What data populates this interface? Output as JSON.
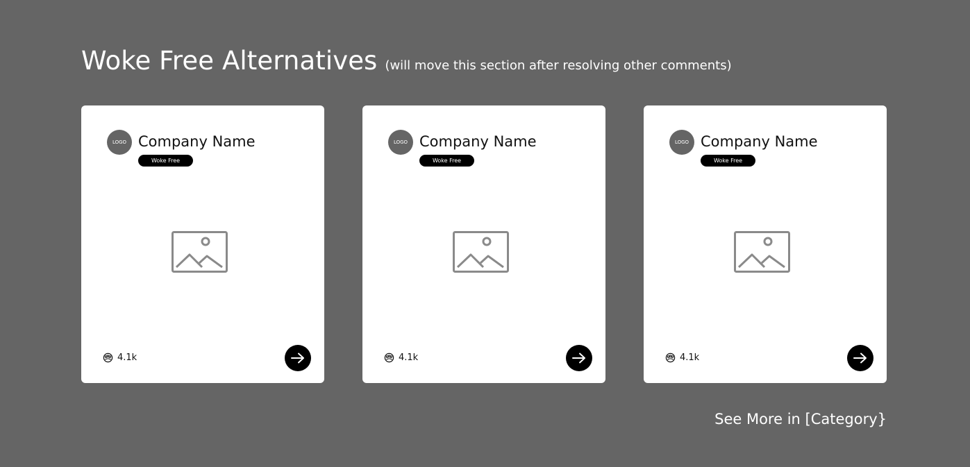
{
  "section": {
    "title": "Woke Free Alternatives",
    "subtitle": "(will move this section after resolving other comments)"
  },
  "cards": [
    {
      "logo_text": "LOGO",
      "company_name": "Company Name",
      "badge": "Woke Free",
      "stat_icon": "people-group-icon",
      "stat_value": "4.1k",
      "image_icon": "image-placeholder-icon",
      "action_icon": "arrow-right-icon"
    },
    {
      "logo_text": "LOGO",
      "company_name": "Company Name",
      "badge": "Woke Free",
      "stat_icon": "people-group-icon",
      "stat_value": "4.1k",
      "image_icon": "image-placeholder-icon",
      "action_icon": "arrow-right-icon"
    },
    {
      "logo_text": "LOGO",
      "company_name": "Company Name",
      "badge": "Woke Free",
      "stat_icon": "people-group-icon",
      "stat_value": "4.1k",
      "image_icon": "image-placeholder-icon",
      "action_icon": "arrow-right-icon"
    }
  ],
  "footer": {
    "see_more_label": "See More in [Category}"
  },
  "colors": {
    "background": "#656565",
    "card": "#ffffff",
    "badge": "#000000",
    "placeholder_stroke": "#8a8a8a"
  }
}
